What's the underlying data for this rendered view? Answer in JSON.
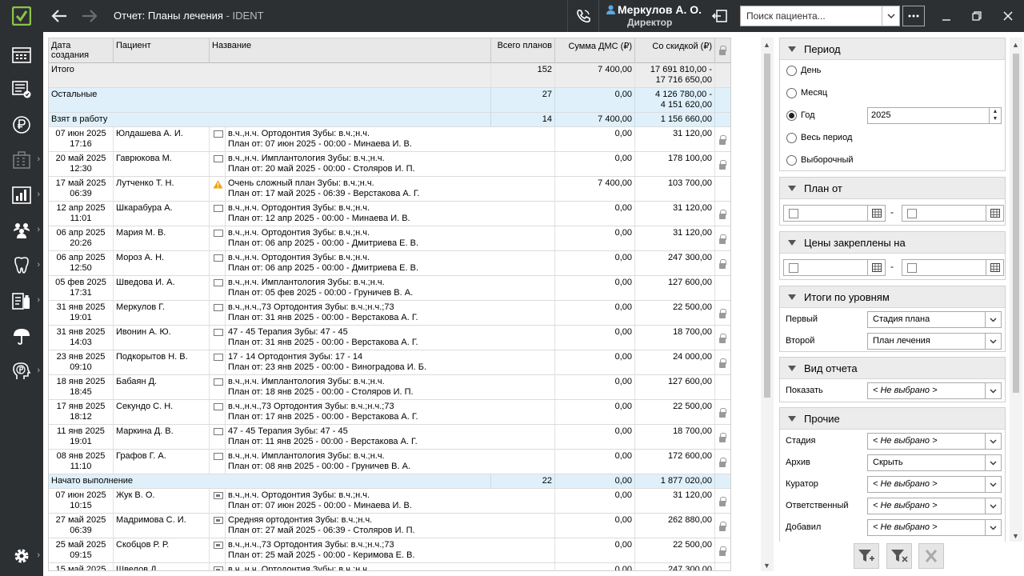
{
  "window": {
    "title": "Отчет: Планы лечения",
    "app_name": "IDENT"
  },
  "user": {
    "name": "Меркулов А. О.",
    "role": "Директор"
  },
  "search": {
    "placeholder": "Поиск пациента..."
  },
  "sidebar": {
    "icons": [
      "calendar-grid-icon",
      "document-check-icon",
      "ruble-icon",
      "building-icon",
      "chart-icon",
      "people-icon",
      "tooth-icon",
      "clipboard-bottle-icon",
      "umbrella-icon",
      "head-ruble-icon",
      "settings-icon"
    ]
  },
  "grid": {
    "columns": [
      "Дата создания",
      "Пациент",
      "Название",
      "Всего планов",
      "Сумма ДМС (₽)",
      "Со скидкой (₽)"
    ],
    "rows": [
      {
        "type": "total",
        "label": "Итого",
        "count": "152",
        "dms": "7 400,00",
        "discount": "17 691 810,00 -",
        "discount2": "17 716 650,00",
        "lock": false
      },
      {
        "type": "group",
        "label": "Остальные",
        "count": "27",
        "dms": "0,00",
        "discount": "4 126 780,00 -",
        "discount2": "4 151 620,00",
        "lock": false
      },
      {
        "type": "group",
        "label": "Взят в работу",
        "count": "14",
        "dms": "7 400,00",
        "discount": "1 156 660,00",
        "discount2": "",
        "lock": false
      },
      {
        "type": "data",
        "date": "07 июн 2025",
        "time": "17:16",
        "patient": "Юлдашева А. И.",
        "icon": "box",
        "name": "в.ч.,н.ч. Ортодонтия   Зубы: в.ч.;н.ч.",
        "plan": "План от: 07 июн 2025 - 00:00 - Минаева И. В.",
        "dms": "0,00",
        "discount": "31 120,00",
        "lock": true
      },
      {
        "type": "data",
        "date": "20 май 2025",
        "time": "12:30",
        "patient": "Гаврюкова М.",
        "icon": "box",
        "name": "в.ч.,н.ч. Имплантология   Зубы: в.ч.;н.ч.",
        "plan": "План от: 20 май 2025 - 00:00 - Столяров И. П.",
        "dms": "0,00",
        "discount": "178 100,00",
        "lock": true
      },
      {
        "type": "data",
        "date": "17 май 2025",
        "time": "06:39",
        "patient": "Лутченко Т. Н.",
        "icon": "warning",
        "name": "Очень сложный план   Зубы: в.ч.;н.ч.",
        "plan": "План от: 17 май 2025 - 06:39 - Верстакова А. Г.",
        "dms": "7 400,00",
        "discount": "103 700,00",
        "lock": false
      },
      {
        "type": "data",
        "date": "12 апр 2025",
        "time": "11:01",
        "patient": "Шкарабура А.",
        "icon": "box",
        "name": "в.ч.,н.ч. Ортодонтия   Зубы: в.ч.;н.ч.",
        "plan": "План от: 12 апр 2025 - 00:00 - Минаева И. В.",
        "dms": "0,00",
        "discount": "31 120,00",
        "lock": true
      },
      {
        "type": "data",
        "date": "06 апр 2025",
        "time": "20:26",
        "patient": "Мария М. В.",
        "icon": "box",
        "name": "в.ч.,н.ч. Ортодонтия   Зубы: в.ч.;н.ч.",
        "plan": "План от: 06 апр 2025 - 00:00 - Дмитриева Е. В.",
        "dms": "0,00",
        "discount": "31 120,00",
        "lock": true
      },
      {
        "type": "data",
        "date": "06 апр 2025",
        "time": "12:50",
        "patient": "Мороз А. Н.",
        "icon": "box",
        "name": "в.ч.,н.ч. Ортодонтия   Зубы: в.ч.;н.ч.",
        "plan": "План от: 06 апр 2025 - 00:00 - Дмитриева Е. В.",
        "dms": "0,00",
        "discount": "247 300,00",
        "lock": true
      },
      {
        "type": "data",
        "date": "05 фев 2025",
        "time": "17:31",
        "patient": "Шведова И. А.",
        "icon": "box",
        "name": "в.ч.,н.ч. Имплантология   Зубы: в.ч.;н.ч.",
        "plan": "План от: 05 фев 2025 - 00:00 - Груничев В. А.",
        "dms": "0,00",
        "discount": "127 600,00",
        "lock": false
      },
      {
        "type": "data",
        "date": "31 янв 2025",
        "time": "19:01",
        "patient": "Меркулов Г.",
        "icon": "box",
        "name": "в.ч.,н.ч.,73 Ортодонтия   Зубы: в.ч.;н.ч.;73",
        "plan": "План от: 31 янв 2025 - 00:00 - Верстакова А. Г.",
        "dms": "0,00",
        "discount": "22 500,00",
        "lock": true
      },
      {
        "type": "data",
        "date": "31 янв 2025",
        "time": "14:03",
        "patient": "Ивонин А. Ю.",
        "icon": "box",
        "name": "47 - 45 Терапия   Зубы: 47 - 45",
        "plan": "План от: 31 янв 2025 - 00:00 - Верстакова А. Г.",
        "dms": "0,00",
        "discount": "18 700,00",
        "lock": true
      },
      {
        "type": "data",
        "date": "23 янв 2025",
        "time": "09:10",
        "patient": "Подкорытов Н. В.",
        "icon": "box",
        "name": "17 - 14 Ортодонтия   Зубы: 17 - 14",
        "plan": "План от: 23 янв 2025 - 00:00 - Виноградова И. Б.",
        "dms": "0,00",
        "discount": "24 000,00",
        "lock": true
      },
      {
        "type": "data",
        "date": "18 янв 2025",
        "time": "18:45",
        "patient": "Бабаян Д.",
        "icon": "box",
        "name": "в.ч.,н.ч. Имплантология   Зубы: в.ч.;н.ч.",
        "plan": "План от: 18 янв 2025 - 00:00 - Столяров И. П.",
        "dms": "0,00",
        "discount": "127 600,00",
        "lock": false
      },
      {
        "type": "data",
        "date": "17 янв 2025",
        "time": "18:12",
        "patient": "Секундо С. Н.",
        "icon": "box",
        "name": "в.ч.,н.ч.,73 Ортодонтия   Зубы: в.ч.;н.ч.;73",
        "plan": "План от: 17 янв 2025 - 00:00 - Верстакова А. Г.",
        "dms": "0,00",
        "discount": "22 500,00",
        "lock": true
      },
      {
        "type": "data",
        "date": "11 янв 2025",
        "time": "19:01",
        "patient": "Маркина Д. В.",
        "icon": "box",
        "name": "47 - 45 Терапия   Зубы: 47 - 45",
        "plan": "План от: 11 янв 2025 - 00:00 - Верстакова А. Г.",
        "dms": "0,00",
        "discount": "18 700,00",
        "lock": true
      },
      {
        "type": "data",
        "date": "08 янв 2025",
        "time": "11:10",
        "patient": "Графов Г. А.",
        "icon": "box",
        "name": "в.ч.,н.ч. Имплантология   Зубы: в.ч.;н.ч.",
        "plan": "План от: 08 янв 2025 - 00:00 - Груничев В. А.",
        "dms": "0,00",
        "discount": "172 600,00",
        "lock": true
      },
      {
        "type": "group",
        "label": "Начато выполнение",
        "count": "22",
        "dms": "0,00",
        "discount": "1 877 020,00",
        "discount2": "",
        "lock": false
      },
      {
        "type": "data",
        "date": "07 июн 2025",
        "time": "10:15",
        "patient": "Жук В. О.",
        "icon": "boxfill",
        "name": "в.ч.,н.ч. Ортодонтия   Зубы: в.ч.;н.ч.",
        "plan": "План от: 07 июн 2025 - 00:00 - Минаева И. В.",
        "dms": "0,00",
        "discount": "31 120,00",
        "lock": true
      },
      {
        "type": "data",
        "date": "27 май 2025",
        "time": "06:39",
        "patient": "Мадримова С. И.",
        "icon": "boxfill",
        "name": "Средняя ортодонтия   Зубы: в.ч.;н.ч.",
        "plan": "План от: 27 май 2025 - 06:39 - Столяров И. П.",
        "dms": "0,00",
        "discount": "262 880,00",
        "lock": true
      },
      {
        "type": "data",
        "date": "25 май 2025",
        "time": "09:15",
        "patient": "Скобцов Р. Р.",
        "icon": "boxfill",
        "name": "в.ч.,н.ч.,73 Ортодонтия   Зубы: в.ч.;н.ч.;73",
        "plan": "План от: 25 май 2025 - 00:00 - Керимова Е. В.",
        "dms": "0,00",
        "discount": "22 500,00",
        "lock": true
      },
      {
        "type": "data",
        "date": "15 май 2025",
        "time": "",
        "patient": "Швелов Д.",
        "icon": "boxfill",
        "name": "в.ч.,н.ч. Ортодонтия   Зубы: в.ч.;н.ч.",
        "plan": "",
        "dms": "0,00",
        "discount": "247 300,00",
        "lock": false
      }
    ]
  },
  "filters": {
    "period": {
      "title": "Период",
      "options": [
        "День",
        "Месяц",
        "Год",
        "Весь период",
        "Выборочный"
      ],
      "selected": "Год",
      "year": "2025"
    },
    "plan_from": {
      "title": "План от"
    },
    "prices_fixed": {
      "title": "Цены закреплены на"
    },
    "levels": {
      "title": "Итоги по уровням",
      "first_label": "Первый",
      "first_value": "Стадия плана",
      "second_label": "Второй",
      "second_value": "План лечения"
    },
    "report_type": {
      "title": "Вид отчета",
      "show_label": "Показать",
      "show_value": "< Не выбрано >"
    },
    "other": {
      "title": "Прочие",
      "items": [
        {
          "label": "Стадия",
          "value": "< Не выбрано >",
          "italic": true
        },
        {
          "label": "Архив",
          "value": "Скрыть",
          "italic": false
        },
        {
          "label": "Куратор",
          "value": "< Не выбрано >",
          "italic": true
        },
        {
          "label": "Ответственный",
          "value": "< Не выбрано >",
          "italic": true
        },
        {
          "label": "Добавил",
          "value": "< Не выбрано >",
          "italic": true
        }
      ]
    }
  },
  "bottom_buttons": [
    "filter-add-icon",
    "filter-clear-icon",
    "close-x-icon"
  ]
}
